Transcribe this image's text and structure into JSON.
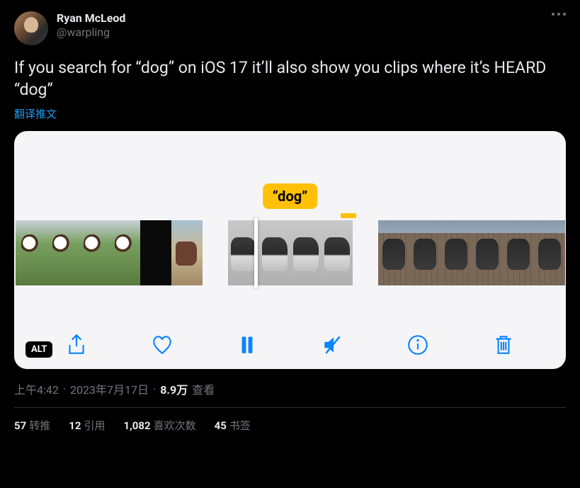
{
  "author": {
    "display_name": "Ryan McLeod",
    "handle": "@warpling"
  },
  "tweet_text": "If you search for “dog” on iOS 17 it’ll also show you clips where it’s HEARD “dog”",
  "translate_label": "翻译推文",
  "media": {
    "search_tag": "“dog”",
    "alt_badge": "ALT",
    "toolbar": {
      "share": "share",
      "like": "like",
      "pause": "pause",
      "mute": "mute",
      "info": "info",
      "trash": "trash"
    }
  },
  "meta": {
    "time": "上午4:42",
    "sep1": " · ",
    "date": "2023年7月17日",
    "sep2": " · ",
    "views_count": "8.9万",
    "views_label": " 查看"
  },
  "engagement": {
    "retweets": {
      "count": "57",
      "label": "转推"
    },
    "quotes": {
      "count": "12",
      "label": "引用"
    },
    "likes": {
      "count": "1,082",
      "label": "喜欢次数"
    },
    "bookmarks": {
      "count": "45",
      "label": "书签"
    }
  }
}
